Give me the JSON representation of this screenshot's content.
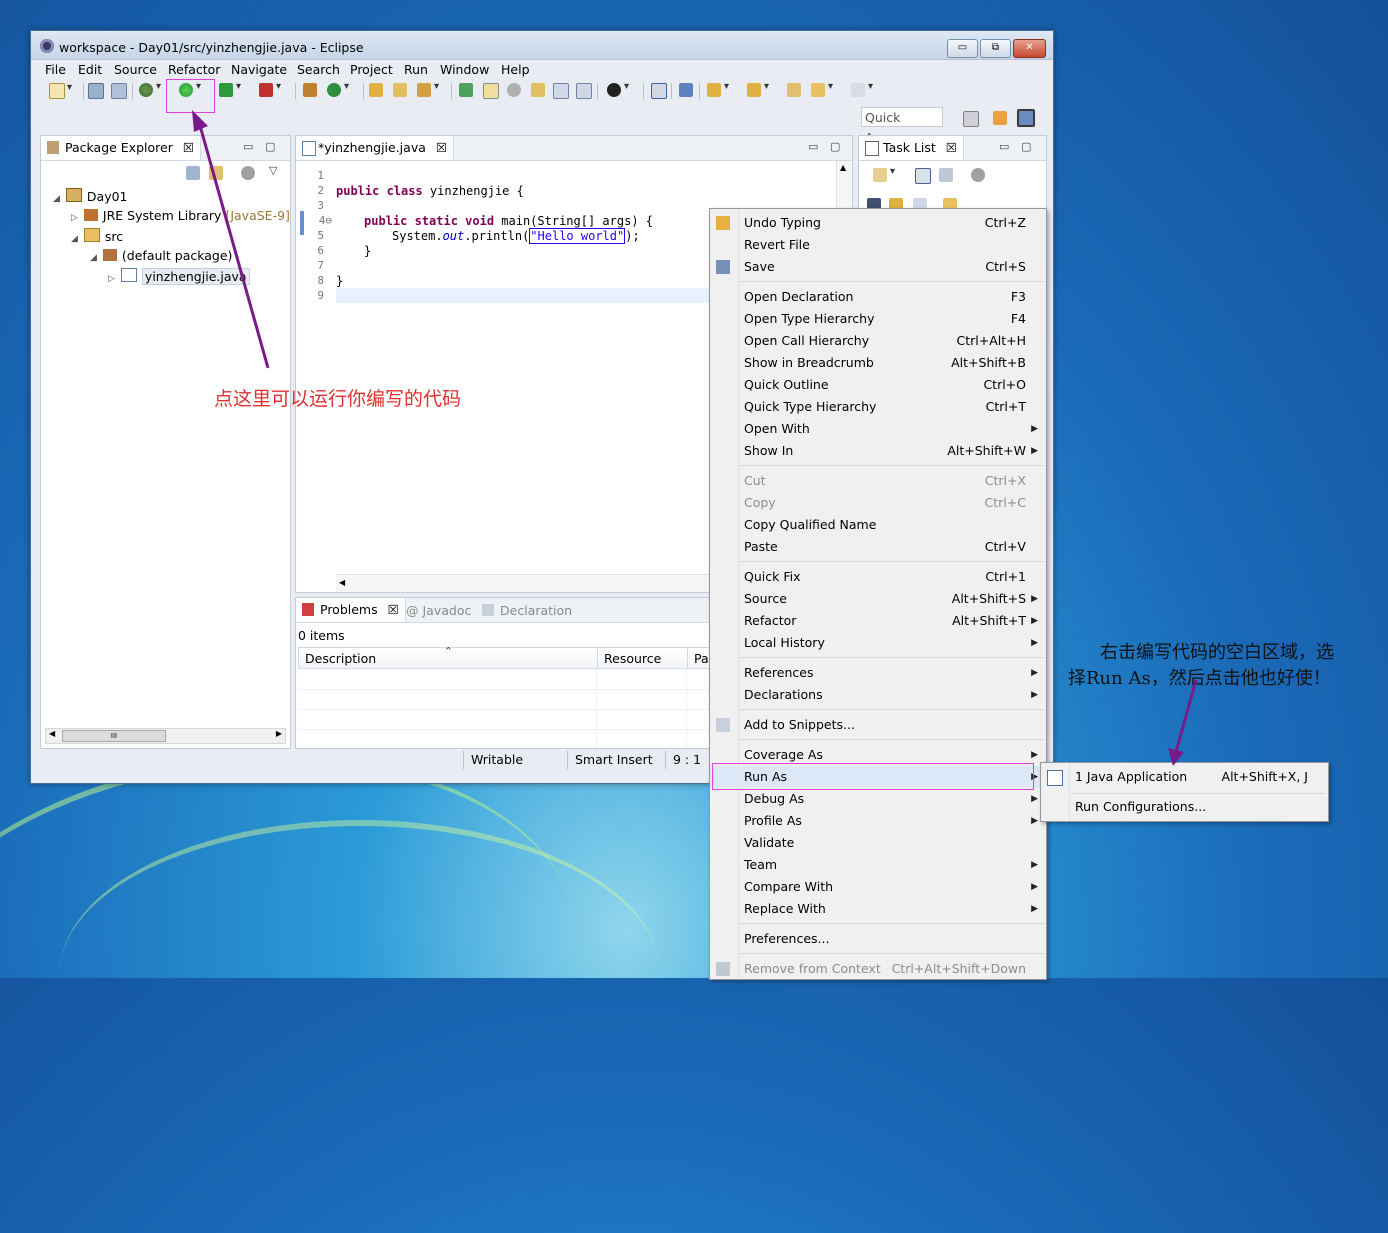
{
  "window": {
    "title": "workspace - Day01/src/yinzhengjie.java - Eclipse",
    "buttons": {
      "minimize": "▭",
      "maximize": "⧉",
      "close": "✕"
    }
  },
  "menubar": [
    "File",
    "Edit",
    "Source",
    "Refactor",
    "Navigate",
    "Search",
    "Project",
    "Run",
    "Window",
    "Help"
  ],
  "quick_access": "Quick Access",
  "package_explorer": {
    "tab": "Package Explorer",
    "tree": [
      {
        "arrow": "◢",
        "label": "Day01"
      },
      {
        "arrow": "▷",
        "label": "JRE System Library",
        "extra": "[JavaSE-9]"
      },
      {
        "arrow": "◢",
        "label": "src"
      },
      {
        "arrow": "◢",
        "label": "(default package)"
      },
      {
        "arrow": "▷",
        "label": "yinzhengjie.java"
      }
    ],
    "hscroll_label": "III"
  },
  "editor": {
    "tab": "*yinzhengjie.java",
    "line_numbers": [
      "1",
      "2",
      "3",
      "4⊖",
      "5",
      "6",
      "7",
      "8",
      "9"
    ],
    "lines": [
      {
        "kw": "",
        "text": ""
      },
      {
        "kw": "public class",
        "text": " yinzhengjie {"
      },
      {
        "kw": "",
        "text": ""
      },
      {
        "kw": "public static void",
        "text": " main(String[] args) {"
      },
      {
        "pre": "System.",
        "fld": "out",
        "mid": ".println(",
        "str": "\"Hello world\"",
        "post": ");"
      },
      {
        "kw": "",
        "text": "}"
      },
      {
        "kw": "",
        "text": ""
      },
      {
        "kw": "",
        "text": "}"
      },
      {
        "kw": "",
        "text": ""
      }
    ]
  },
  "task_list": {
    "tab": "Task List"
  },
  "bottom": {
    "tabs": [
      "Problems",
      "Javadoc",
      "Declaration"
    ],
    "count": "0 items",
    "columns": [
      "Description",
      "Resource",
      "Pat"
    ]
  },
  "statusbar": {
    "writable": "Writable",
    "insert": "Smart Insert",
    "position": "9 : 1"
  },
  "context_menu": [
    {
      "label": "Undo Typing",
      "acc": "Ctrl+Z",
      "icon": "undo-icon"
    },
    {
      "label": "Revert File",
      "acc": ""
    },
    {
      "label": "Save",
      "acc": "Ctrl+S",
      "icon": "save-icon"
    },
    {
      "sep": true
    },
    {
      "label": "Open Declaration",
      "acc": "F3"
    },
    {
      "label": "Open Type Hierarchy",
      "acc": "F4"
    },
    {
      "label": "Open Call Hierarchy",
      "acc": "Ctrl+Alt+H"
    },
    {
      "label": "Show in Breadcrumb",
      "acc": "Alt+Shift+B"
    },
    {
      "label": "Quick Outline",
      "acc": "Ctrl+O"
    },
    {
      "label": "Quick Type Hierarchy",
      "acc": "Ctrl+T"
    },
    {
      "label": "Open With",
      "acc": "",
      "sub": true
    },
    {
      "label": "Show In",
      "acc": "Alt+Shift+W",
      "sub": true
    },
    {
      "sep": true
    },
    {
      "label": "Cut",
      "acc": "Ctrl+X",
      "disabled": true
    },
    {
      "label": "Copy",
      "acc": "Ctrl+C",
      "disabled": true
    },
    {
      "label": "Copy Qualified Name",
      "acc": ""
    },
    {
      "label": "Paste",
      "acc": "Ctrl+V"
    },
    {
      "sep": true
    },
    {
      "label": "Quick Fix",
      "acc": "Ctrl+1"
    },
    {
      "label": "Source",
      "acc": "Alt+Shift+S",
      "sub": true
    },
    {
      "label": "Refactor",
      "acc": "Alt+Shift+T",
      "sub": true
    },
    {
      "label": "Local History",
      "acc": "",
      "sub": true
    },
    {
      "sep": true
    },
    {
      "label": "References",
      "acc": "",
      "sub": true
    },
    {
      "label": "Declarations",
      "acc": "",
      "sub": true
    },
    {
      "sep": true
    },
    {
      "label": "Add to Snippets...",
      "acc": "",
      "icon": "snippet-icon"
    },
    {
      "sep": true
    },
    {
      "label": "Coverage As",
      "acc": "",
      "sub": true
    },
    {
      "label": "Run As",
      "acc": "",
      "sub": true,
      "highlight": true
    },
    {
      "label": "Debug As",
      "acc": "",
      "sub": true
    },
    {
      "label": "Profile As",
      "acc": "",
      "sub": true
    },
    {
      "label": "Validate",
      "acc": ""
    },
    {
      "label": "Team",
      "acc": "",
      "sub": true
    },
    {
      "label": "Compare With",
      "acc": "",
      "sub": true
    },
    {
      "label": "Replace With",
      "acc": "",
      "sub": true
    },
    {
      "sep": true
    },
    {
      "label": "Preferences...",
      "acc": ""
    },
    {
      "sep": true
    },
    {
      "label": "Remove from Context",
      "acc": "Ctrl+Alt+Shift+Down",
      "disabled": true,
      "icon": "context-icon"
    }
  ],
  "submenu": [
    {
      "label": "1 Java Application",
      "acc": "Alt+Shift+X, J"
    },
    {
      "label": "Run Configurations...",
      "acc": ""
    }
  ],
  "annotations": {
    "run_hint": "点这里可以运行你编写的代码",
    "runas_hint_line1": "右击编写代码的空白区域，选",
    "runas_hint_line2": "择Run As，然后点击他也好使！"
  },
  "colors": {
    "annotation_red": "#e03030",
    "arrow_purple": "#7a1a8a",
    "highlight_magenta": "#e040e0"
  }
}
